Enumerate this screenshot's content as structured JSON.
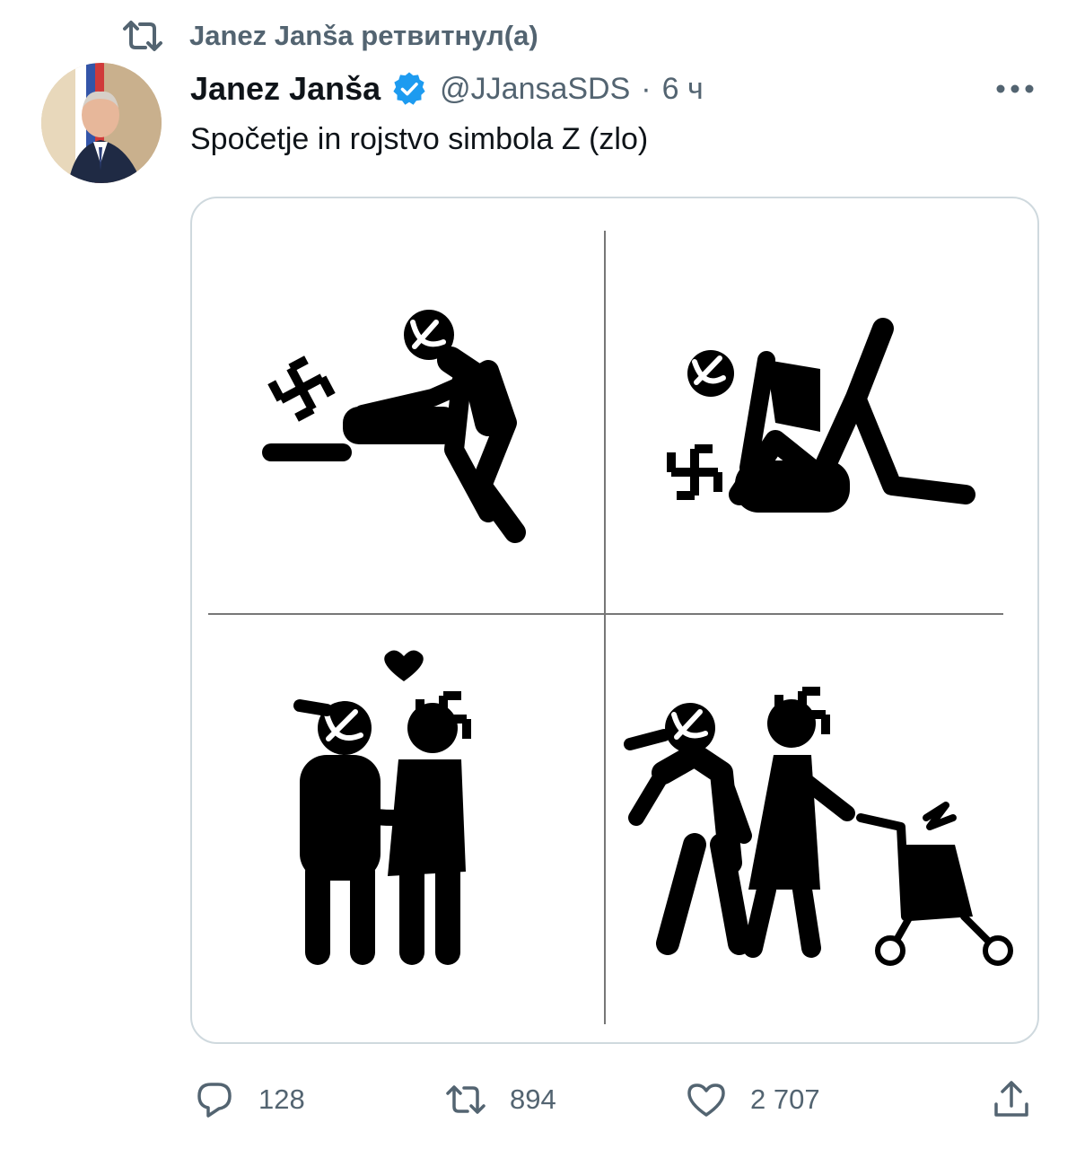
{
  "retweet_banner": {
    "text": "Janez Janša ретвитнул(а)",
    "icon": "retweet-icon"
  },
  "author": {
    "display_name": "Janez Janša",
    "verified_icon": "verified-badge-icon",
    "handle": "@JJansaSDS",
    "separator": "·",
    "time": "6 ч"
  },
  "tweet": {
    "text": "Spočetje in rojstvo simbola Z (zlo)",
    "more_icon": "more-icon"
  },
  "actions": {
    "reply_count": "128",
    "retweet_count": "894",
    "like_count": "2 707",
    "reply_icon": "reply-icon",
    "retweet_icon": "retweet-icon",
    "like_icon": "heart-icon",
    "share_icon": "share-icon"
  },
  "colors": {
    "text_primary": "#0f1419",
    "text_secondary": "#536471",
    "verified_blue": "#1d9bf0",
    "border": "#cfd9de"
  }
}
